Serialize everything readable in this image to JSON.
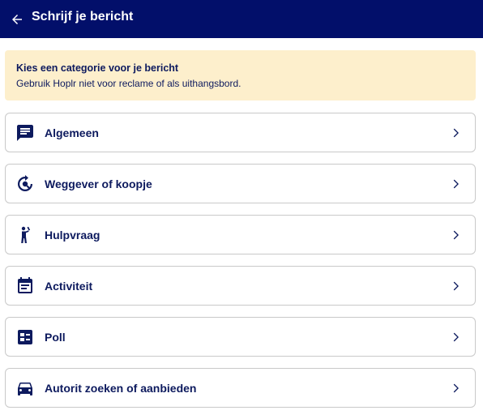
{
  "header": {
    "title": "Schrijf je bericht",
    "back_icon": "arrow-left-icon"
  },
  "notice": {
    "title": "Kies een categorie voor je bericht",
    "text": "Gebruik Hoplr niet voor reclame of als uithangsbord."
  },
  "categories": [
    {
      "label": "Algemeen",
      "icon": "message-icon"
    },
    {
      "label": "Weggever of koopje",
      "icon": "giveaway-icon"
    },
    {
      "label": "Hulpvraag",
      "icon": "help-person-icon"
    },
    {
      "label": "Activiteit",
      "icon": "calendar-icon"
    },
    {
      "label": "Poll",
      "icon": "poll-icon"
    },
    {
      "label": "Autorit zoeken of aanbieden",
      "icon": "car-icon"
    }
  ],
  "colors": {
    "header_bg": "#020f6a",
    "notice_bg": "#fdefcc",
    "text_primary": "#0d1a5e",
    "border": "#c9c9c9"
  }
}
